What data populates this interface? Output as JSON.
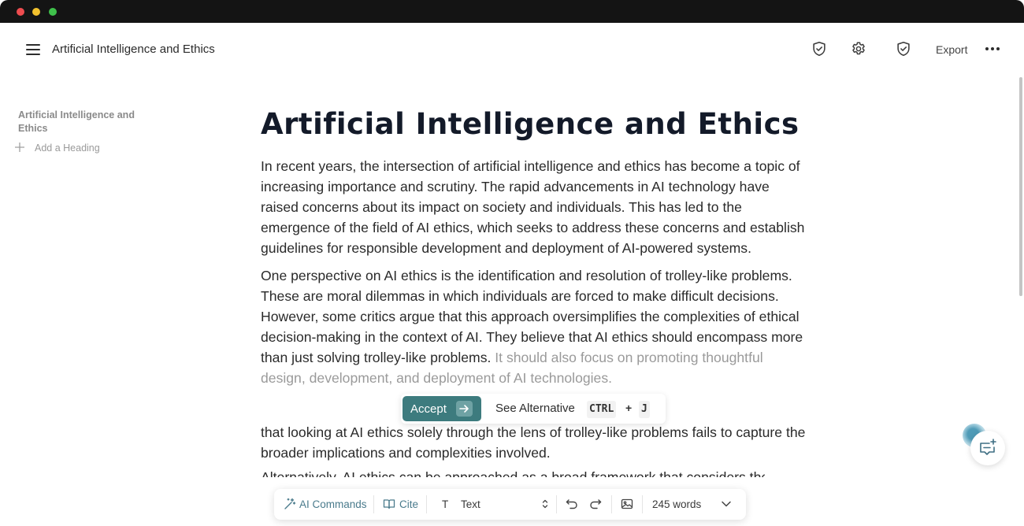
{
  "window": {
    "controls": [
      "close",
      "minimize",
      "maximize"
    ]
  },
  "header": {
    "doc_title": "Artificial Intelligence and Ethics",
    "export_label": "Export",
    "icons": [
      "menu-icon",
      "shield-check-icon",
      "gear-icon",
      "shield-check-icon",
      "more-icon"
    ]
  },
  "outline": {
    "title": "Artificial Intelligence and Ethics",
    "add_heading": "Add a Heading"
  },
  "document": {
    "heading": "Artificial Intelligence and Ethics",
    "paragraph1": "In recent years, the intersection of artificial intelligence and ethics has become a topic of increasing importance and scrutiny. The rapid advancements in AI technology have raised concerns about its impact on society and individuals. This has led to the emergence of the field of AI ethics, which seeks to address these concerns and establish guidelines for responsible development and deployment of AI-powered systems.",
    "paragraph2": "One perspective on AI ethics is the identification and resolution of trolley-like problems. These are moral dilemmas in which individuals are forced to make difficult decisions. However, some critics argue that this approach oversimplifies the complexities of ethical decision-making in the context of AI. They believe that AI ethics should encompass more than just solving trolley-like problems.",
    "suggestion": "It should also focus on promoting thoughtful design, development, and deployment of AI technologies.",
    "paragraph3": "that looking at AI ethics solely through the lens of trolley-like problems fails to capture the broader implications and complexities involved.",
    "partial_line": "Alternatively, AI ethics can be approached as a broad framework that considers the ethical"
  },
  "suggestion_bar": {
    "accept_label": "Accept",
    "alternative_label": "See Alternative",
    "shortcut_key1": "CTRL",
    "shortcut_plus": "+",
    "shortcut_key2": "J"
  },
  "toolbar": {
    "ai_commands": "AI Commands",
    "cite": "Cite",
    "text_style_icon": "T",
    "text_style": "Text",
    "word_count": "245 words"
  },
  "colors": {
    "accent": "#3d7b7e",
    "suggestion_text": "#9a9a9a",
    "titlebar": "#141414",
    "toolbar_link": "#4a7b8c"
  }
}
